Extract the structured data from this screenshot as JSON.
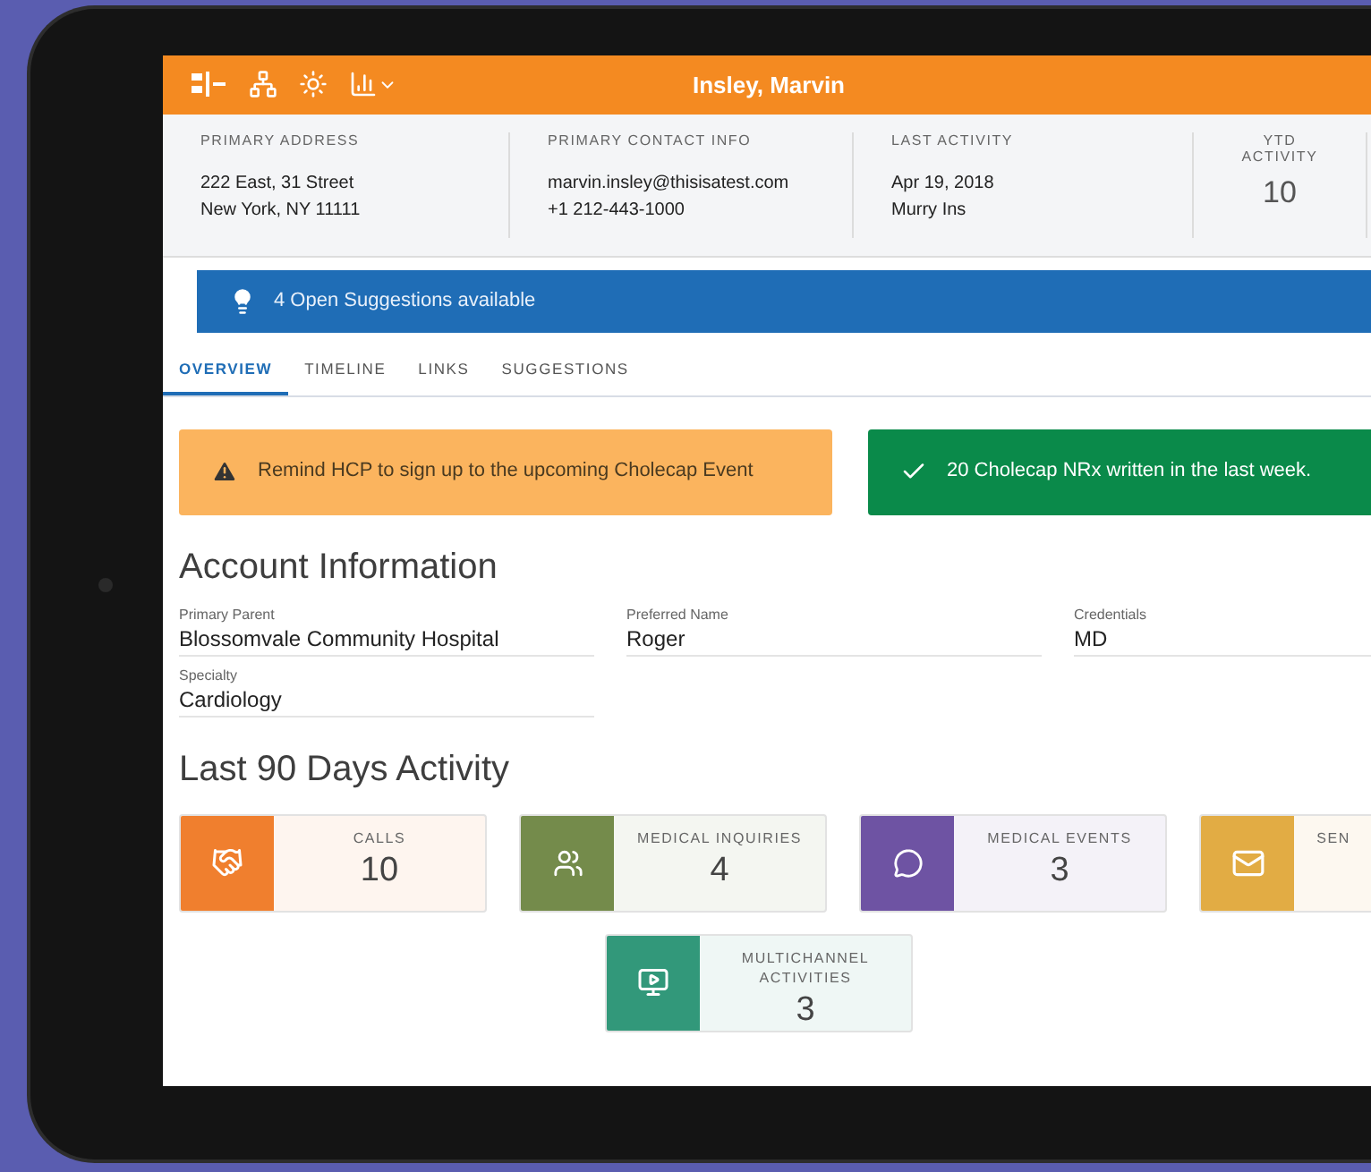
{
  "header": {
    "title": "Insley, Marvin"
  },
  "summary": [
    {
      "kind": "lines",
      "label": "PRIMARY ADDRESS",
      "lines": [
        "222 East, 31 Street",
        "New York, NY 11111"
      ]
    },
    {
      "kind": "lines",
      "label": "PRIMARY CONTACT INFO",
      "lines": [
        "marvin.insley@thisisatest.com",
        "+1 212-443-1000"
      ]
    },
    {
      "kind": "lines",
      "label": "LAST ACTIVITY",
      "lines": [
        "Apr 19, 2018",
        "Murry Ins"
      ]
    },
    {
      "kind": "metric",
      "label": "YTD ACTIVITY",
      "value": "10"
    }
  ],
  "suggestions_banner": {
    "text": "4 Open Suggestions available"
  },
  "tabs": [
    {
      "label": "OVERVIEW",
      "selected": true
    },
    {
      "label": "TIMELINE",
      "selected": false
    },
    {
      "label": "LINKS",
      "selected": false
    },
    {
      "label": "SUGGESTIONS",
      "selected": false
    }
  ],
  "alerts": [
    {
      "kind": "warning",
      "text": "Remind HCP to sign up to the upcoming Cholecap Event"
    },
    {
      "kind": "success",
      "text": "20 Cholecap NRx written in the last week."
    }
  ],
  "account_information": {
    "title": "Account Information",
    "fields": [
      {
        "label": "Primary Parent",
        "value": "Blossomvale Community Hospital"
      },
      {
        "label": "Preferred Name",
        "value": "Roger"
      },
      {
        "label": "Credentials",
        "value": "MD"
      },
      {
        "label": "Specialty",
        "value": "Cardiology"
      }
    ]
  },
  "activity": {
    "title": "Last 90 Days Activity",
    "card_rows": [
      {
        "cards": [
          {
            "kind": "calls",
            "label": "CALLS",
            "value": "10",
            "color": "#f07f2e"
          },
          {
            "kind": "inquiries",
            "label": "MEDICAL INQUIRIES",
            "value": "4",
            "color": "#748b4b"
          },
          {
            "kind": "events",
            "label": "MEDICAL EVENTS",
            "value": "3",
            "color": "#6e53a3"
          },
          {
            "kind": "email",
            "label": "SEN",
            "color": "#e2ac44"
          }
        ]
      },
      {
        "cards": [
          {
            "kind": "multichannel",
            "label": "MULTICHANNEL ACTIVITIES",
            "value": "3",
            "color": "#32987a"
          }
        ]
      }
    ]
  }
}
